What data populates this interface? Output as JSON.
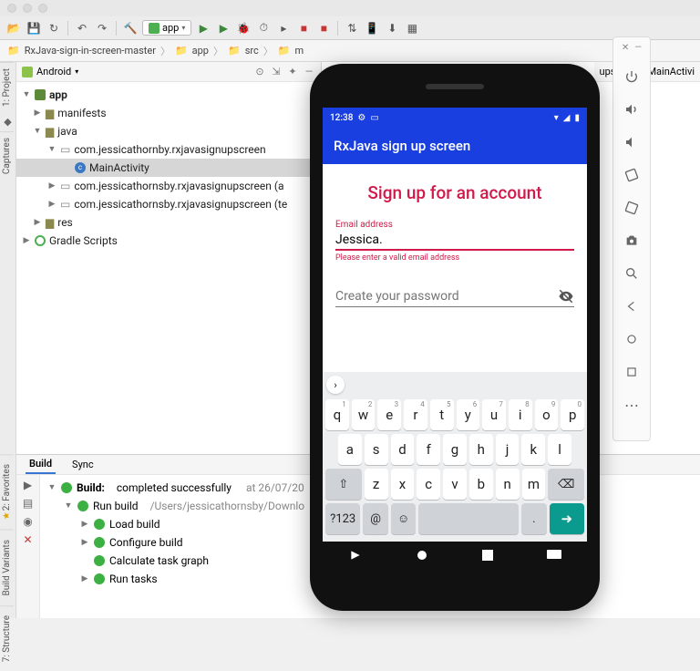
{
  "breadcrumb": {
    "root": "RxJava-sign-in-screen-master",
    "parts": [
      "app",
      "src",
      "m"
    ],
    "truncated_end": "ups",
    "editor_file": "MainActivi"
  },
  "toolbar": {
    "run_config": "app"
  },
  "project": {
    "mode": "Android",
    "root": "app",
    "nodes": {
      "manifests": "manifests",
      "java": "java",
      "pkg1": "com.jessicathornby.rxjavasignupscreen",
      "main_activity": "MainActivity",
      "pkg2": "com.jessicathornsby.rxjavasignupscreen (a",
      "pkg3": "com.jessicathornsby.rxjavasignupscreen (te",
      "res": "res",
      "gradle": "Gradle Scripts"
    }
  },
  "build": {
    "tab_build": "Build",
    "tab_sync": "Sync",
    "heading": "Build:",
    "status": "completed successfully",
    "status_at": "at 26/07/20",
    "run_build": "Run build",
    "run_build_path": "/Users/jessicathornsby/Downlo",
    "load": "Load build",
    "configure": "Configure build",
    "calc": "Calculate task graph",
    "run_tasks": "Run tasks"
  },
  "gutter": {
    "project": "1: Project",
    "captures": "Captures",
    "favorites": "2: Favorites",
    "build_variants": "Build Variants",
    "structure": "7: Structure"
  },
  "emu": {
    "status_time": "12:38",
    "wifi": "▾",
    "signal": "◢",
    "batt": "▮",
    "app_title": "RxJava sign up screen",
    "signup_title": "Sign up for an account",
    "email_label": "Email address",
    "email_value": "Jessica.",
    "email_error": "Please enter a valid email address",
    "pwd_placeholder": "Create your password"
  },
  "keyboard": {
    "row1": [
      [
        "q",
        "1"
      ],
      [
        "w",
        "2"
      ],
      [
        "e",
        "3"
      ],
      [
        "r",
        "4"
      ],
      [
        "t",
        "5"
      ],
      [
        "y",
        "6"
      ],
      [
        "u",
        "7"
      ],
      [
        "i",
        "8"
      ],
      [
        "o",
        "9"
      ],
      [
        "p",
        "0"
      ]
    ],
    "row2": [
      "a",
      "s",
      "d",
      "f",
      "g",
      "h",
      "j",
      "k",
      "l"
    ],
    "row3": [
      "z",
      "x",
      "c",
      "v",
      "b",
      "n",
      "m"
    ],
    "sym": "?123",
    "at": "@",
    "period": "."
  }
}
